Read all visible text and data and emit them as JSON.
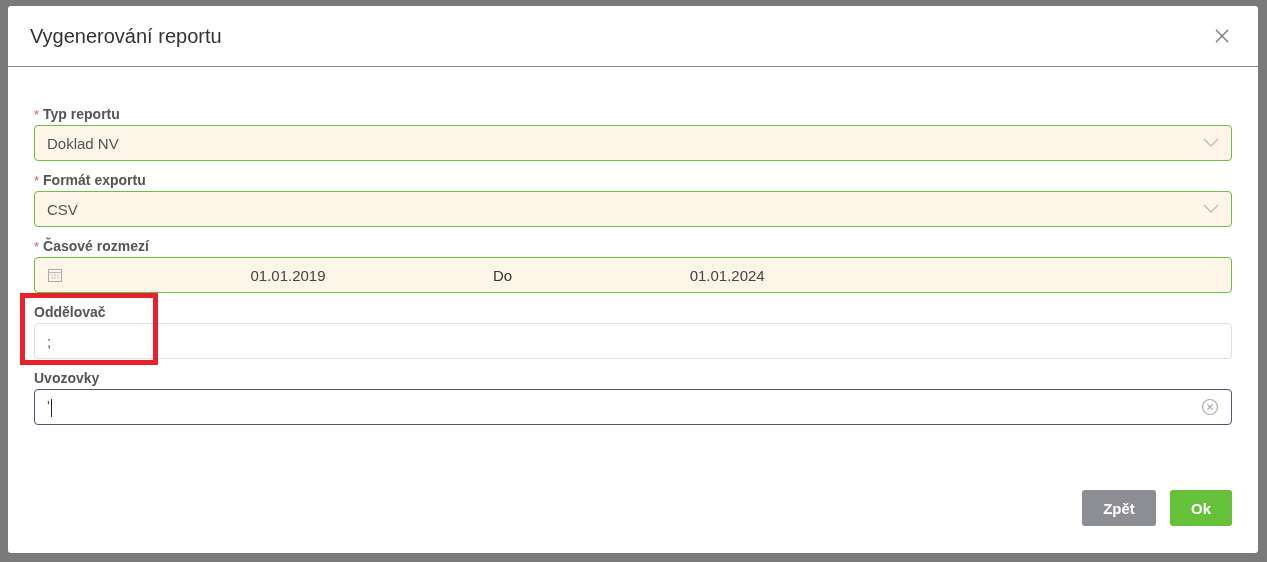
{
  "dialog": {
    "title": "Vygenerování reportu"
  },
  "fields": [
    {
      "kind": "select",
      "label": "Typ reportu",
      "required_mark": "*",
      "valid": true,
      "focused": false,
      "value": "Doklad NV"
    },
    {
      "kind": "select",
      "label": "Formát exportu",
      "required_mark": "*",
      "valid": true,
      "focused": false,
      "value": "CSV"
    },
    {
      "kind": "daterange",
      "label": "Časové rozmezí",
      "required_mark": "*",
      "valid": true,
      "focused": false,
      "from": "01.01.2019",
      "separator": "Do",
      "to": "01.01.2024"
    },
    {
      "kind": "text",
      "label": "Oddělovač",
      "valid": false,
      "focused": false,
      "highlighted": true,
      "value": ";"
    },
    {
      "kind": "text",
      "label": "Uvozovky",
      "valid": false,
      "focused": true,
      "clearable": true,
      "value": "'"
    }
  ],
  "buttons": [
    {
      "kind": "secondary",
      "label": "Zpět"
    },
    {
      "kind": "primary",
      "label": "Ok"
    }
  ]
}
